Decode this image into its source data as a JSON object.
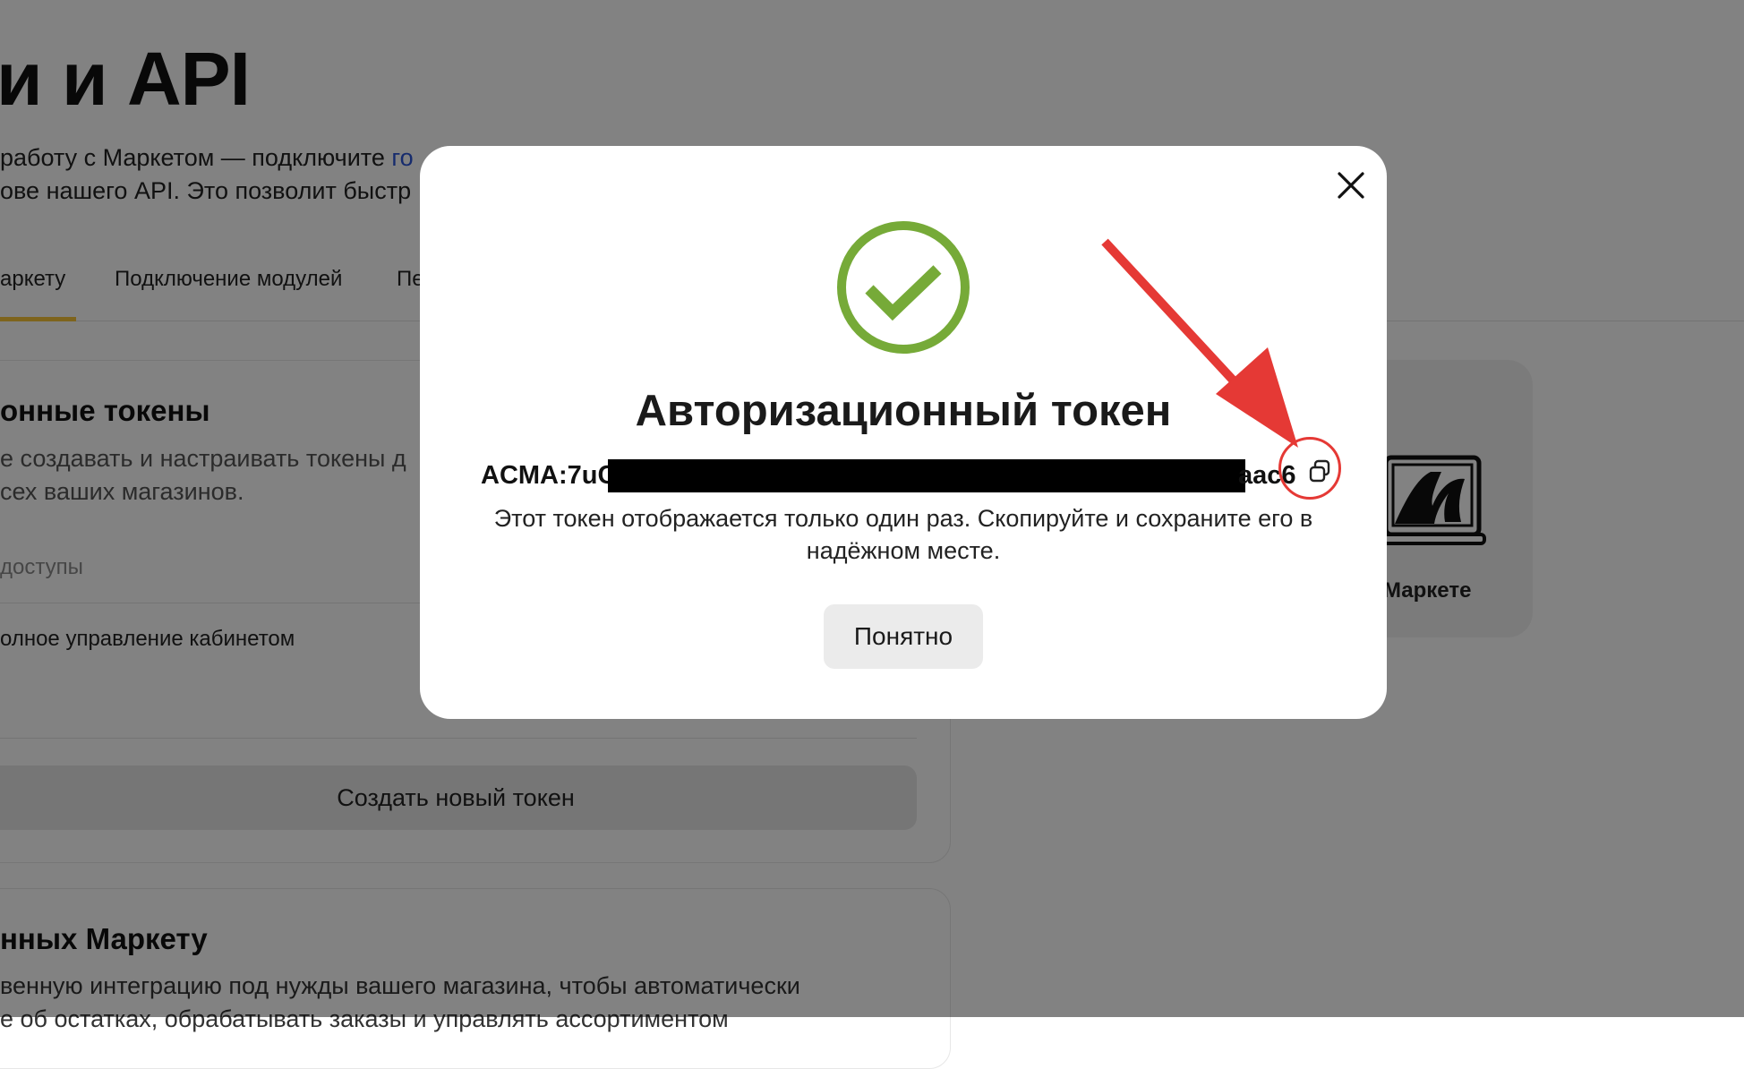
{
  "page": {
    "title": "и и API",
    "intro_line1": "работу с Маркетом — подключите ",
    "intro_link_fragment": "го",
    "intro_line2": "ове нашего API. Это позволит быстр"
  },
  "tabs": {
    "active": "аркету",
    "modules": "Подключение модулей",
    "cut": "Пе"
  },
  "tokens_section": {
    "title": "онные токены",
    "text_line1": "е создавать и настраивать токены д",
    "text_line2": "сех ваших магазинов.",
    "access_label": "доступы",
    "access_value": "олное управление кабинетом",
    "create_button": "Создать новый токен"
  },
  "integration_section": {
    "title": "нных Маркету",
    "text_line1": "венную интеграцию под нужды вашего магазина, чтобы автоматически",
    "text_line2": "е об остатках, обрабатывать заказы и управлять ассортиментом"
  },
  "promo": {
    "caption": "Маркете"
  },
  "modal": {
    "title": "Авторизационный токен",
    "token_prefix": "ACMA:7uC",
    "token_suffix": "aac6",
    "note": "Этот токен отображается только один раз. Скопируйте и сохраните его в надёжном месте.",
    "ok_button": "Понятно",
    "icons": {
      "success": "check-circle-icon",
      "copy": "copy-icon",
      "close": "close-icon"
    }
  },
  "colors": {
    "success_green": "#76aa38",
    "annotation_red": "#e53935",
    "accent_yellow": "#f7c43a",
    "link_blue": "#2b55d6"
  }
}
